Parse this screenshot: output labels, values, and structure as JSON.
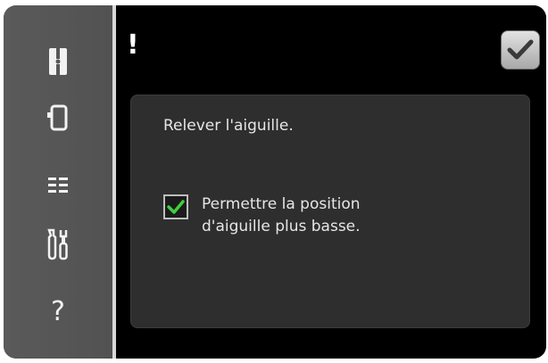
{
  "sidebar": {
    "items": [
      {
        "icon": "needle-icon"
      },
      {
        "icon": "presser-foot-icon"
      },
      {
        "icon": "stitch-list-icon"
      },
      {
        "icon": "tools-icon"
      },
      {
        "icon": "help-icon",
        "glyph": "?"
      }
    ]
  },
  "header": {
    "alert_symbol": "!",
    "confirm_icon": "checkmark-icon"
  },
  "dialog": {
    "message": "Relever l'aiguille.",
    "option_line1": "Permettre la position",
    "option_line2": "d'aiguille plus basse.",
    "option_checked": true
  },
  "colors": {
    "check_green": "#3fcf3f",
    "screen": "#000000",
    "frame": "#585858"
  }
}
